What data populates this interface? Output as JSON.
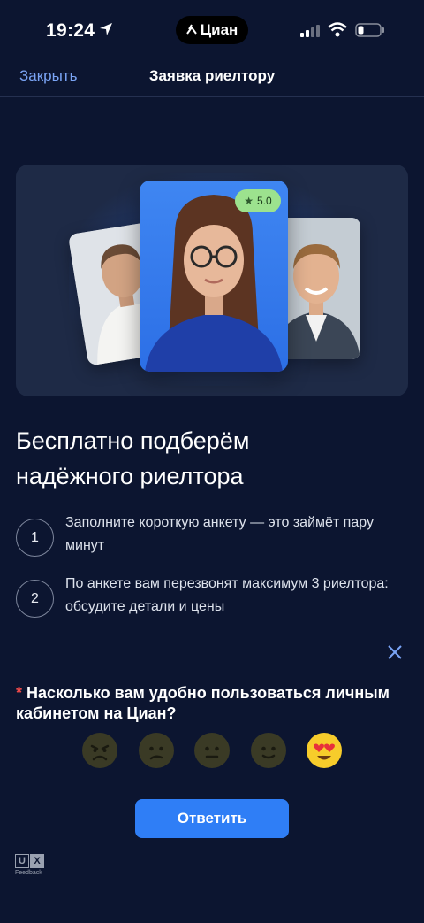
{
  "status_bar": {
    "time": "19:24",
    "app_name": "Циан",
    "icons": [
      "location-arrow-icon",
      "cellular-signal-icon",
      "wifi-icon",
      "battery-icon"
    ]
  },
  "nav": {
    "close_label": "Закрыть",
    "title": "Заявка риелтору"
  },
  "hero": {
    "rating": "5.0",
    "icons": [
      "star-icon"
    ]
  },
  "headline": {
    "line1": "Бесплатно подберём",
    "line2": "надёжного риелтора"
  },
  "steps": [
    {
      "number": "1",
      "text": "Заполните короткую анкету — это займёт пару минут"
    },
    {
      "number": "2",
      "text": "По анкете вам перезвонят максимум 3 риелтора: обсудите детали и цены"
    }
  ],
  "survey": {
    "required_mark": "*",
    "question": "Насколько вам удобно пользоваться личным кабинетом на Циан?",
    "options": [
      "angry-face",
      "sad-face",
      "neutral-face",
      "slight-smile-face",
      "heart-eyes-face"
    ],
    "selected_option": "heart-eyes-face",
    "answer_label": "Ответить"
  },
  "footer": {
    "logo_letters": [
      "U",
      "X"
    ],
    "logo_caption": "Feedback"
  },
  "colors": {
    "background": "#0c1530",
    "accent": "#2f7ef6",
    "link": "#7aa4f5",
    "rating_badge": "#9ce28e",
    "required": "#f04a4a"
  }
}
